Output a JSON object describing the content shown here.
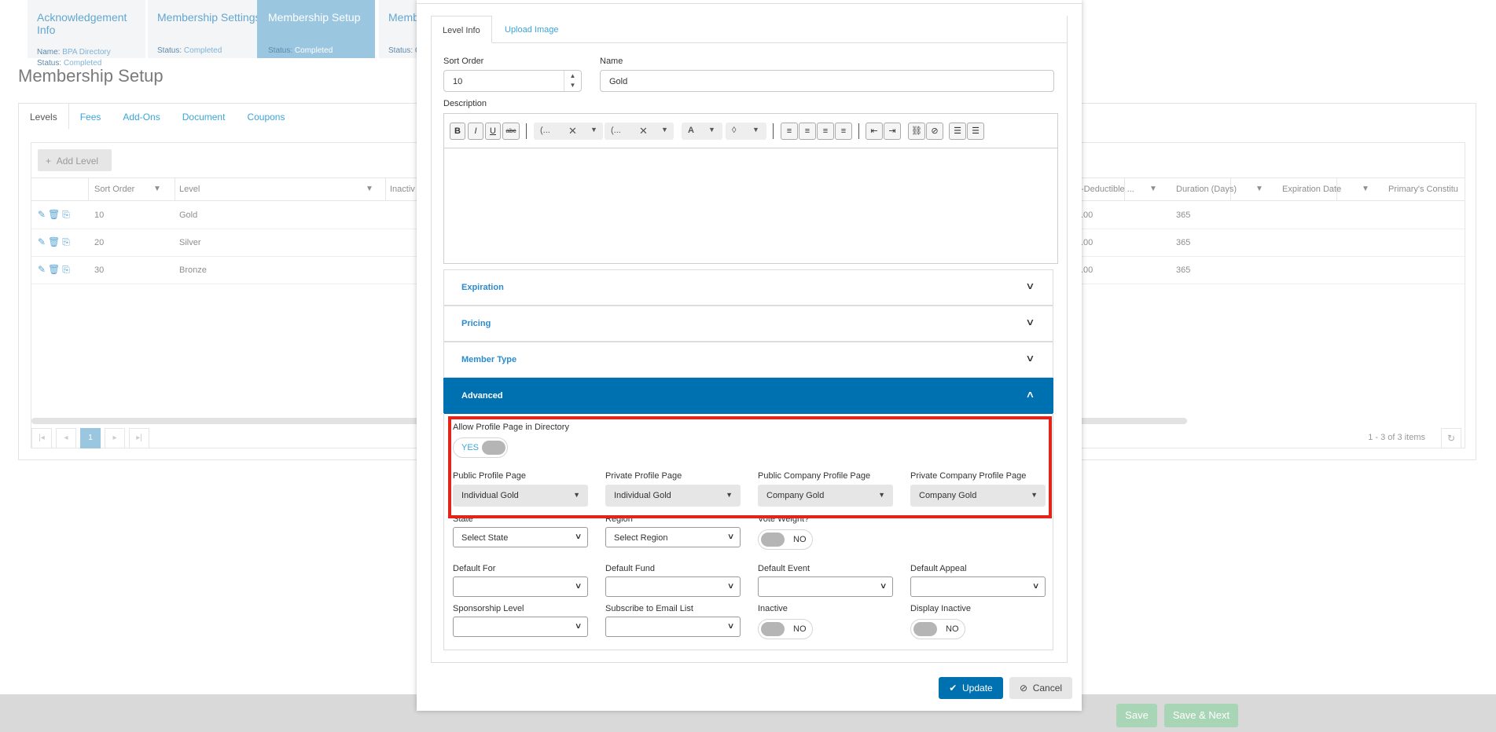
{
  "wizard": {
    "steps": [
      {
        "title": "Acknowledgement Info",
        "name_label": "Name:",
        "name_value": "BPA Directory",
        "status_label": "Status:",
        "status_value": "Completed"
      },
      {
        "title": "Membership Settings",
        "status_label": "Status:",
        "status_value": "Completed"
      },
      {
        "title": "Membership Setup",
        "status_label": "Status:",
        "status_value": "Completed"
      },
      {
        "title": "Membe",
        "status_label": "Status: C"
      }
    ]
  },
  "page": {
    "title": "Membership Setup",
    "tabs": [
      "Levels",
      "Fees",
      "Add-Ons",
      "Document",
      "Coupons"
    ],
    "add_level": "Add Level",
    "columns": [
      "Sort Order",
      "Level",
      "Inactiv",
      "-Deductible ...",
      "Duration (Days)",
      "Expiration Date",
      "Primary's Constitu"
    ],
    "rows": [
      {
        "sort": "10",
        "level": "Gold",
        "deductible": ".00",
        "duration": "365"
      },
      {
        "sort": "20",
        "level": "Silver",
        "deductible": ".00",
        "duration": "365"
      },
      {
        "sort": "30",
        "level": "Bronze",
        "deductible": ".00",
        "duration": "365"
      }
    ],
    "pager_current": "1",
    "pager_info": "1 - 3 of 3 items"
  },
  "footer": {
    "save": "Save",
    "save_next": "Save & Next"
  },
  "modal": {
    "tabs": [
      "Level Info",
      "Upload Image"
    ],
    "sort_order": {
      "label": "Sort Order",
      "value": "10"
    },
    "name": {
      "label": "Name",
      "value": "Gold"
    },
    "description_label": "Description",
    "editor": {
      "bold": "B",
      "italic": "I",
      "underline": "U",
      "strike": "abc",
      "font_family": "(...",
      "font_size": "(...",
      "font_color": "A"
    },
    "sections": {
      "expiration": "Expiration",
      "pricing": "Pricing",
      "member_type": "Member Type",
      "advanced": "Advanced"
    },
    "advanced": {
      "allow_profile_label": "Allow Profile Page in Directory",
      "allow_profile_toggle": "YES",
      "public_profile": {
        "label": "Public Profile Page",
        "value": "Individual Gold"
      },
      "private_profile": {
        "label": "Private Profile Page",
        "value": "Individual Gold"
      },
      "public_company": {
        "label": "Public Company Profile Page",
        "value": "Company Gold"
      },
      "private_company": {
        "label": "Private Company Profile Page",
        "value": "Company Gold"
      },
      "state": {
        "label": "State",
        "value": "Select State"
      },
      "region": {
        "label": "Region",
        "value": "Select Region"
      },
      "vote_weight": {
        "label": "Vote Weight?",
        "toggle": "NO"
      },
      "default_for": {
        "label": "Default For",
        "value": ""
      },
      "default_fund": {
        "label": "Default Fund",
        "value": ""
      },
      "default_event": {
        "label": "Default Event",
        "value": ""
      },
      "default_appeal": {
        "label": "Default Appeal",
        "value": ""
      },
      "sponsorship_level": {
        "label": "Sponsorship Level",
        "value": ""
      },
      "subscribe_email": {
        "label": "Subscribe to Email List",
        "value": ""
      },
      "inactive": {
        "label": "Inactive",
        "toggle": "NO"
      },
      "display_inactive": {
        "label": "Display Inactive",
        "toggle": "NO"
      }
    },
    "buttons": {
      "update": "Update",
      "cancel": "Cancel"
    }
  },
  "colors": {
    "primary": "#0071b0",
    "link": "#3aa5d8",
    "highlight": "#e4231b",
    "save_green": "#a8d5b5"
  }
}
